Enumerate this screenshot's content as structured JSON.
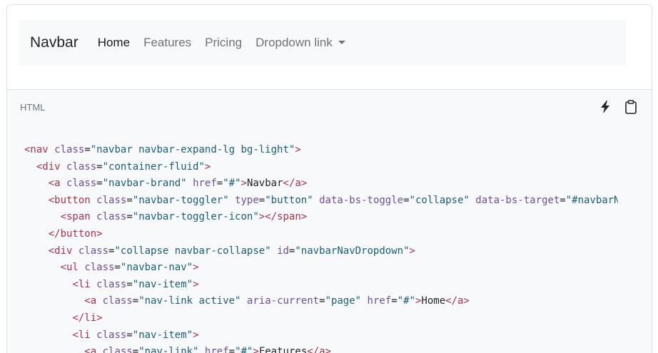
{
  "preview": {
    "brand": "Navbar",
    "links": [
      {
        "label": "Home",
        "active": true
      },
      {
        "label": "Features",
        "active": false
      },
      {
        "label": "Pricing",
        "active": false
      },
      {
        "label": "Dropdown link",
        "active": false,
        "dropdown": true
      }
    ]
  },
  "code_header": {
    "language": "HTML",
    "actions": [
      "lightning-icon",
      "clipboard-icon"
    ]
  },
  "code_lines": [
    [
      {
        "k": "p",
        "s": ""
      },
      {
        "k": "t",
        "s": "<nav"
      },
      {
        "k": "p",
        "s": " "
      },
      {
        "k": "a",
        "s": "class"
      },
      {
        "k": "p",
        "s": "="
      },
      {
        "k": "v",
        "s": "\"navbar navbar-expand-lg bg-light\""
      },
      {
        "k": "t",
        "s": ">"
      }
    ],
    [
      {
        "k": "p",
        "s": "  "
      },
      {
        "k": "t",
        "s": "<div"
      },
      {
        "k": "p",
        "s": " "
      },
      {
        "k": "a",
        "s": "class"
      },
      {
        "k": "p",
        "s": "="
      },
      {
        "k": "v",
        "s": "\"container-fluid\""
      },
      {
        "k": "t",
        "s": ">"
      }
    ],
    [
      {
        "k": "p",
        "s": "    "
      },
      {
        "k": "t",
        "s": "<a"
      },
      {
        "k": "p",
        "s": " "
      },
      {
        "k": "a",
        "s": "class"
      },
      {
        "k": "p",
        "s": "="
      },
      {
        "k": "v",
        "s": "\"navbar-brand\""
      },
      {
        "k": "p",
        "s": " "
      },
      {
        "k": "a",
        "s": "href"
      },
      {
        "k": "p",
        "s": "="
      },
      {
        "k": "v",
        "s": "\"#\""
      },
      {
        "k": "t",
        "s": ">"
      },
      {
        "k": "p",
        "s": "Navbar"
      },
      {
        "k": "t",
        "s": "</a>"
      }
    ],
    [
      {
        "k": "p",
        "s": "    "
      },
      {
        "k": "t",
        "s": "<button"
      },
      {
        "k": "p",
        "s": " "
      },
      {
        "k": "a",
        "s": "class"
      },
      {
        "k": "p",
        "s": "="
      },
      {
        "k": "v",
        "s": "\"navbar-toggler\""
      },
      {
        "k": "p",
        "s": " "
      },
      {
        "k": "a",
        "s": "type"
      },
      {
        "k": "p",
        "s": "="
      },
      {
        "k": "v",
        "s": "\"button\""
      },
      {
        "k": "p",
        "s": " "
      },
      {
        "k": "a",
        "s": "data-bs-toggle"
      },
      {
        "k": "p",
        "s": "="
      },
      {
        "k": "v",
        "s": "\"collapse\""
      },
      {
        "k": "p",
        "s": " "
      },
      {
        "k": "a",
        "s": "data-bs-target"
      },
      {
        "k": "p",
        "s": "="
      },
      {
        "k": "v",
        "s": "\"#navbarNavDropdown\""
      }
    ],
    [
      {
        "k": "p",
        "s": "      "
      },
      {
        "k": "t",
        "s": "<span"
      },
      {
        "k": "p",
        "s": " "
      },
      {
        "k": "a",
        "s": "class"
      },
      {
        "k": "p",
        "s": "="
      },
      {
        "k": "v",
        "s": "\"navbar-toggler-icon\""
      },
      {
        "k": "t",
        "s": "></span>"
      }
    ],
    [
      {
        "k": "p",
        "s": "    "
      },
      {
        "k": "t",
        "s": "</button>"
      }
    ],
    [
      {
        "k": "p",
        "s": "    "
      },
      {
        "k": "t",
        "s": "<div"
      },
      {
        "k": "p",
        "s": " "
      },
      {
        "k": "a",
        "s": "class"
      },
      {
        "k": "p",
        "s": "="
      },
      {
        "k": "v",
        "s": "\"collapse navbar-collapse\""
      },
      {
        "k": "p",
        "s": " "
      },
      {
        "k": "a",
        "s": "id"
      },
      {
        "k": "p",
        "s": "="
      },
      {
        "k": "v",
        "s": "\"navbarNavDropdown\""
      },
      {
        "k": "t",
        "s": ">"
      }
    ],
    [
      {
        "k": "p",
        "s": "      "
      },
      {
        "k": "t",
        "s": "<ul"
      },
      {
        "k": "p",
        "s": " "
      },
      {
        "k": "a",
        "s": "class"
      },
      {
        "k": "p",
        "s": "="
      },
      {
        "k": "v",
        "s": "\"navbar-nav\""
      },
      {
        "k": "t",
        "s": ">"
      }
    ],
    [
      {
        "k": "p",
        "s": "        "
      },
      {
        "k": "t",
        "s": "<li"
      },
      {
        "k": "p",
        "s": " "
      },
      {
        "k": "a",
        "s": "class"
      },
      {
        "k": "p",
        "s": "="
      },
      {
        "k": "v",
        "s": "\"nav-item\""
      },
      {
        "k": "t",
        "s": ">"
      }
    ],
    [
      {
        "k": "p",
        "s": "          "
      },
      {
        "k": "t",
        "s": "<a"
      },
      {
        "k": "p",
        "s": " "
      },
      {
        "k": "a",
        "s": "class"
      },
      {
        "k": "p",
        "s": "="
      },
      {
        "k": "v",
        "s": "\"nav-link active\""
      },
      {
        "k": "p",
        "s": " "
      },
      {
        "k": "a",
        "s": "aria-current"
      },
      {
        "k": "p",
        "s": "="
      },
      {
        "k": "v",
        "s": "\"page\""
      },
      {
        "k": "p",
        "s": " "
      },
      {
        "k": "a",
        "s": "href"
      },
      {
        "k": "p",
        "s": "="
      },
      {
        "k": "v",
        "s": "\"#\""
      },
      {
        "k": "t",
        "s": ">"
      },
      {
        "k": "p",
        "s": "Home"
      },
      {
        "k": "t",
        "s": "</a>"
      }
    ],
    [
      {
        "k": "p",
        "s": "        "
      },
      {
        "k": "t",
        "s": "</li>"
      }
    ],
    [
      {
        "k": "p",
        "s": "        "
      },
      {
        "k": "t",
        "s": "<li"
      },
      {
        "k": "p",
        "s": " "
      },
      {
        "k": "a",
        "s": "class"
      },
      {
        "k": "p",
        "s": "="
      },
      {
        "k": "v",
        "s": "\"nav-item\""
      },
      {
        "k": "t",
        "s": ">"
      }
    ],
    [
      {
        "k": "p",
        "s": "          "
      },
      {
        "k": "t",
        "s": "<a"
      },
      {
        "k": "p",
        "s": " "
      },
      {
        "k": "a",
        "s": "class"
      },
      {
        "k": "p",
        "s": "="
      },
      {
        "k": "v",
        "s": "\"nav-link\""
      },
      {
        "k": "p",
        "s": " "
      },
      {
        "k": "a",
        "s": "href"
      },
      {
        "k": "p",
        "s": "="
      },
      {
        "k": "v",
        "s": "\"#\""
      },
      {
        "k": "t",
        "s": ">"
      },
      {
        "k": "p",
        "s": "Features"
      },
      {
        "k": "t",
        "s": "</a>"
      }
    ]
  ],
  "colors": {
    "tag": "#a7334e",
    "attribute": "#6f4e9e",
    "value": "#1a5e7a",
    "navbar_bg": "#f8f9fa",
    "code_bg": "#f8f9fa"
  }
}
